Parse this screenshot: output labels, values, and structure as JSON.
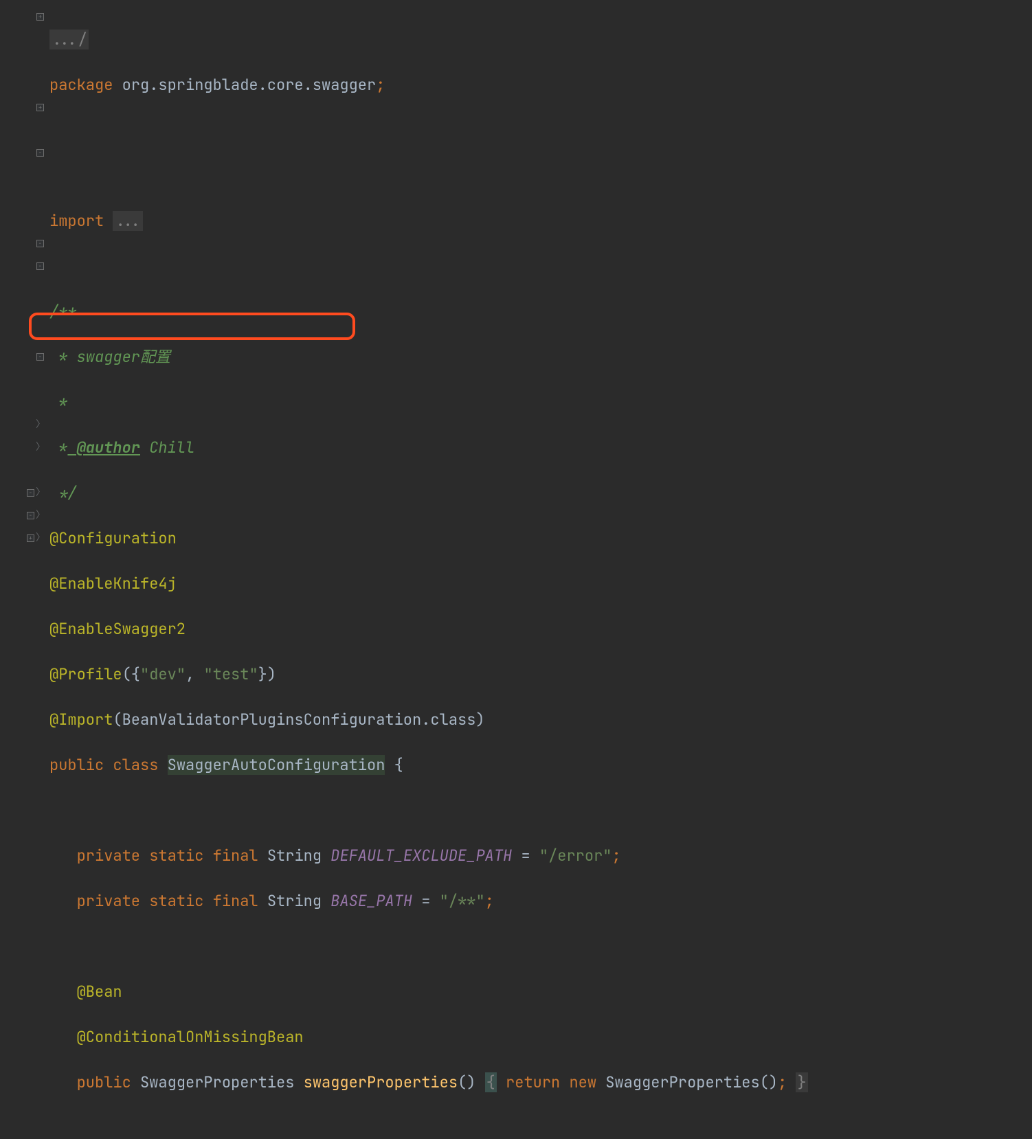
{
  "code": {
    "folded_top": ".../",
    "package_kw": "package",
    "package_name": "org.springblade.core.swagger",
    "import_kw": "import",
    "import_folded": "...",
    "doc_open": "/**",
    "doc_line1_star": " *",
    "doc_line1_text": " swagger配置",
    "doc_line2_star": " *",
    "doc_author_star": " *",
    "doc_author_tag": " @author",
    "doc_author_name": " Chill",
    "doc_close": " */",
    "anno_configuration": "@Configuration",
    "anno_enableknife": "@EnableKnife4j",
    "anno_enableswagger": "@EnableSwagger2",
    "anno_profile": "@Profile",
    "profile_open": "({",
    "profile_dev": "\"dev\"",
    "profile_comma": ", ",
    "profile_test": "\"test\"",
    "profile_close": "})",
    "anno_import": "@Import",
    "import_class": "BeanValidatorPluginsConfiguration",
    "import_dotclass": ".class",
    "public_kw": "public",
    "class_kw": "class",
    "class_name": "SwaggerAutoConfiguration",
    "private_kw": "private",
    "static_kw": "static",
    "final_kw": "final",
    "string_type": "String",
    "const1_name": "DEFAULT_EXCLUDE_PATH",
    "const1_val": "\"/error\"",
    "const2_name": "BASE_PATH",
    "const2_val": "\"/**\"",
    "anno_bean": "@Bean",
    "anno_condmissing": "@ConditionalOnMissingBean",
    "return_type": "SwaggerProperties",
    "method_name": "swaggerProperties",
    "return_kw": "return",
    "new_kw": "new",
    "ctor_name": "SwaggerProperties",
    "eq": " = ",
    "semi": ";",
    "lbrace": " {",
    "rbrace": "}",
    "lparen": "(",
    "rparen": ")",
    "empty_parens": "()"
  }
}
